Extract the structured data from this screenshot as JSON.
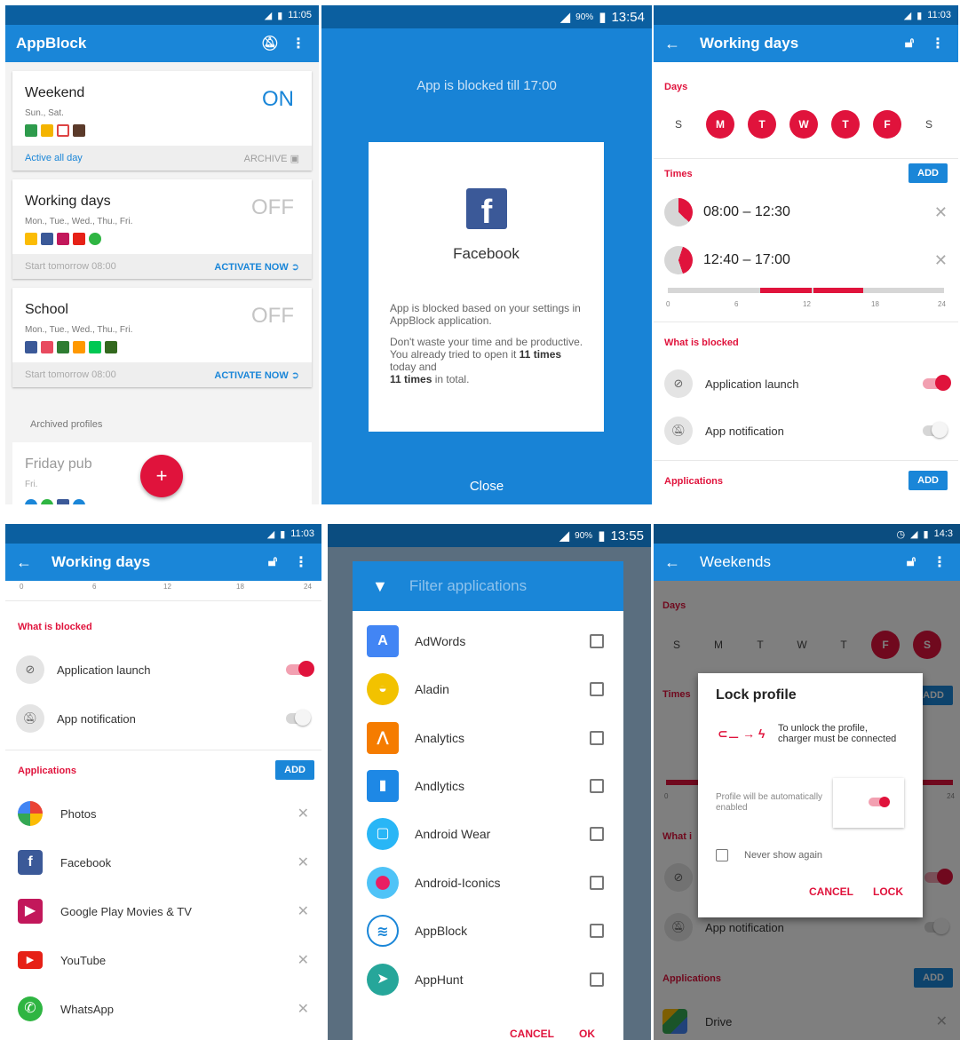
{
  "p1": {
    "status_time": "11:05",
    "app_title": "AppBlock",
    "profiles": [
      {
        "name": "Weekend",
        "days": "Sun., Sat.",
        "state": "ON",
        "foot_left": "Active all day",
        "foot_right": "ARCHIVE"
      },
      {
        "name": "Working days",
        "days": "Mon., Tue., Wed., Thu., Fri.",
        "state": "OFF",
        "foot_left": "Start tomorrow 08:00",
        "foot_right": "ACTIVATE NOW"
      },
      {
        "name": "School",
        "days": "Mon., Tue., Wed., Thu., Fri.",
        "state": "OFF",
        "foot_left": "Start tomorrow 08:00",
        "foot_right": "ACTIVATE NOW"
      }
    ],
    "archived_label": "Archived profiles",
    "archived": {
      "name": "Friday pub",
      "days": "Fri."
    },
    "fab": "+"
  },
  "p2": {
    "status_battery": "90%",
    "status_time": "13:54",
    "blocked_till": "App is blocked till 17:00",
    "app_name": "Facebook",
    "msg1": "App is blocked based on your settings in AppBlock application.",
    "msg2a": "Don't waste your time and be productive. You already tried to open it ",
    "times_today": "11 times",
    "msg2b": " today and",
    "times_total": "11 times",
    "msg2c": " in total.",
    "close": "Close"
  },
  "p3": {
    "status_time": "11:03",
    "title": "Working days",
    "days_label": "Days",
    "days": [
      {
        "l": "S",
        "on": false
      },
      {
        "l": "M",
        "on": true
      },
      {
        "l": "T",
        "on": true
      },
      {
        "l": "W",
        "on": true
      },
      {
        "l": "T",
        "on": true
      },
      {
        "l": "F",
        "on": true
      },
      {
        "l": "S",
        "on": false
      }
    ],
    "times_label": "Times",
    "add": "ADD",
    "time1": "08:00 – 12:30",
    "time2": "12:40 – 17:00",
    "ticks": [
      "0",
      "6",
      "12",
      "18",
      "24"
    ],
    "blocked_label": "What is blocked",
    "opt_launch": "Application launch",
    "opt_notif": "App notification",
    "apps_label": "Applications"
  },
  "p4": {
    "status_time": "11:03",
    "title": "Working days",
    "ticks": [
      "0",
      "6",
      "12",
      "18",
      "24"
    ],
    "blocked_label": "What is blocked",
    "opt_launch": "Application launch",
    "opt_notif": "App notification",
    "apps_label": "Applications",
    "add": "ADD",
    "apps": [
      "Photos",
      "Facebook",
      "Google Play Movies & TV",
      "YouTube",
      "WhatsApp"
    ]
  },
  "p5": {
    "status_battery": "90%",
    "status_time": "13:55",
    "filter_placeholder": "Filter applications",
    "apps": [
      "AdWords",
      "Aladin",
      "Analytics",
      "Andlytics",
      "Android Wear",
      "Android-Iconics",
      "AppBlock",
      "AppHunt"
    ],
    "cancel": "CANCEL",
    "ok": "OK"
  },
  "p6": {
    "status_time": "14:3",
    "title": "Weekends",
    "days_label": "Days",
    "days": [
      {
        "l": "S",
        "on": false
      },
      {
        "l": "M",
        "on": false
      },
      {
        "l": "T",
        "on": false
      },
      {
        "l": "W",
        "on": false
      },
      {
        "l": "T",
        "on": false
      },
      {
        "l": "F",
        "on": true
      },
      {
        "l": "S",
        "on": true
      }
    ],
    "times_label": "Times",
    "add": "ADD",
    "tick_start": "0",
    "tick_end": "24",
    "blocked_label": "What i",
    "opt_notif": "App notification",
    "apps_label": "Applications",
    "app_drive": "Drive",
    "dialog_title": "Lock profile",
    "unlock_text": "To unlock the profile, charger must be connected",
    "auto_text": "Profile will be automatically enabled",
    "never_text": "Never show again",
    "cancel": "CANCEL",
    "lock": "LOCK"
  }
}
